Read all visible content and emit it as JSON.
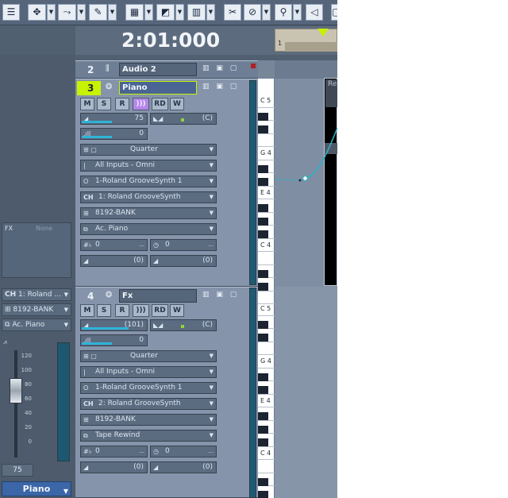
{
  "timecode": "2:01:000",
  "ruler": {
    "bar_number": "1"
  },
  "toolbar": {
    "icons": [
      "add-track-icon",
      "select-tool-icon",
      "draw-line-icon",
      "pencil-tool-icon",
      "snap-grid-icon",
      "crop-tool-icon",
      "event-list-icon",
      "scissors-icon",
      "mute-tool-icon",
      "zoom-icon",
      "audition-icon",
      "more-icon"
    ]
  },
  "left_panel": {
    "fx_label": "FX",
    "fx_value": "None",
    "channel": "1: Roland ...",
    "bank": "8192-BANK",
    "patch": "Ac. Piano",
    "fader_scale": [
      "120",
      "100",
      "80",
      "60",
      "40",
      "20",
      "0"
    ],
    "volume_value": "75",
    "track_name": "Piano",
    "meter_color": "#1e5870"
  },
  "tracks": [
    {
      "number": "2",
      "name": "Audio 2",
      "icon": "waveform-icon"
    },
    {
      "number": "3",
      "name": "Piano",
      "selected": true,
      "buttons": [
        "M",
        "S",
        "R",
        ")))",
        "RD",
        "W"
      ],
      "volume_value": "75",
      "volume_fill": 0.47,
      "pan_value": "(C)",
      "velocity_value": "0",
      "velocity_fill": 0.47,
      "quantize": "Quarter",
      "input": "All Inputs - Omni",
      "output": "1-Roland GrooveSynth 1",
      "channel": "1: Roland GrooveSynth",
      "bank": "8192-BANK",
      "patch": "Ac. Piano",
      "key_offset": "0",
      "time_offset": "0",
      "send1": "(0)",
      "send2": "(0)"
    },
    {
      "number": "4",
      "name": "Fx",
      "buttons": [
        "M",
        "S",
        "R",
        ")))",
        "RD",
        "W"
      ],
      "volume_value": "(101)",
      "volume_fill": 0.72,
      "pan_value": "(C)",
      "velocity_value": "0",
      "velocity_fill": 0.47,
      "quantize": "Quarter",
      "input": "All Inputs - Omni",
      "output": "1-Roland GrooveSynth 1",
      "channel": "2: Roland GrooveSynth",
      "bank": "8192-BANK",
      "patch": "Tape Rewind",
      "key_offset": "0",
      "time_offset": "0",
      "send1": "(0)",
      "send2": "(0)"
    }
  ],
  "piano_keys": {
    "upper": [
      "C 5",
      "G 4",
      "E 4",
      "C 4"
    ],
    "lower": [
      "C 5",
      "G 4",
      "E 4",
      "C 4"
    ]
  },
  "clip": {
    "label": "Re"
  },
  "colors": {
    "accent": "#c8f200",
    "meter": "#2fb3d8",
    "curve": "#29b3c9"
  }
}
